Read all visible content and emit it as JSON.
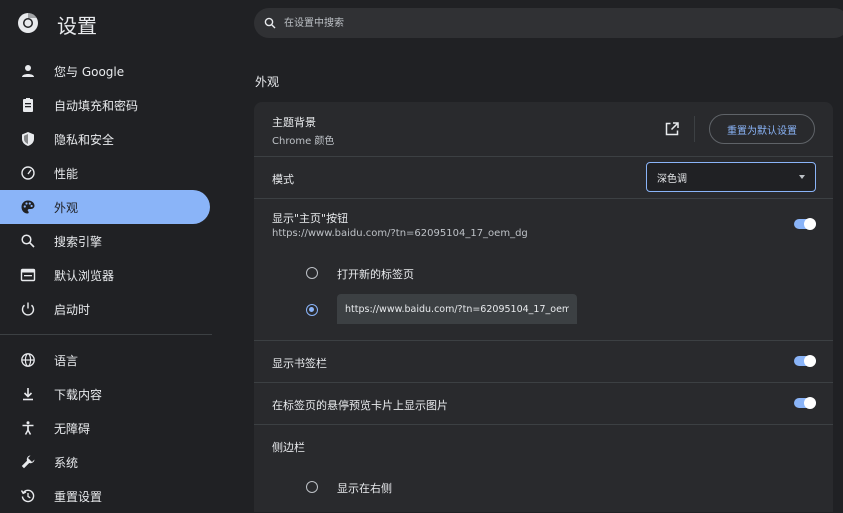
{
  "app": {
    "title": "设置"
  },
  "search": {
    "placeholder": "在设置中搜索"
  },
  "sidebar": {
    "items": [
      {
        "label": "您与 Google"
      },
      {
        "label": "自动填充和密码"
      },
      {
        "label": "隐私和安全"
      },
      {
        "label": "性能"
      },
      {
        "label": "外观",
        "active": true
      },
      {
        "label": "搜索引擎"
      },
      {
        "label": "默认浏览器"
      },
      {
        "label": "启动时"
      }
    ],
    "items2": [
      {
        "label": "语言"
      },
      {
        "label": "下载内容"
      },
      {
        "label": "无障碍"
      },
      {
        "label": "系统"
      },
      {
        "label": "重置设置"
      }
    ]
  },
  "appearance": {
    "section_title": "外观",
    "theme": {
      "title": "主题背景",
      "subtitle": "Chrome 颜色",
      "reset_label": "重置为默认设置"
    },
    "mode": {
      "title": "模式",
      "value": "深色调"
    },
    "home_button": {
      "title": "显示\"主页\"按钮",
      "subtitle": "https://www.baidu.com/?tn=62095104_17_oem_dg",
      "enabled": true,
      "option_new_tab": "打开新的标签页",
      "custom_url_value": "https://www.baidu.com/?tn=62095104_17_oem..."
    },
    "bookmarks_bar": {
      "title": "显示书签栏",
      "enabled": true
    },
    "tab_hover": {
      "title": "在标签页的悬停预览卡片上显示图片",
      "enabled": true
    },
    "side_panel": {
      "title": "侧边栏",
      "option_right": "显示在右侧"
    }
  },
  "colors": {
    "accent": "#8ab4f8",
    "background": "#202124",
    "card": "#292a2d"
  }
}
